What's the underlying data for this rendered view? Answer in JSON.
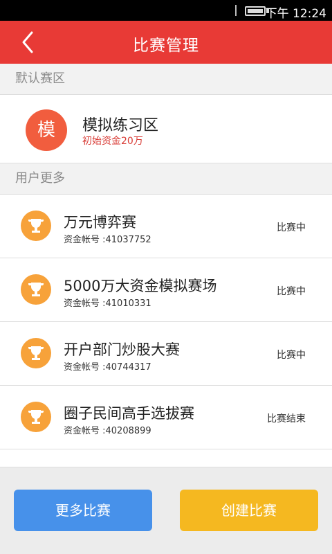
{
  "status_bar": {
    "time": "下午 12:24"
  },
  "header": {
    "title": "比赛管理"
  },
  "default_section": {
    "label": "默认赛区",
    "badge": "模",
    "name": "模拟练习区",
    "funds": "初始资金20万"
  },
  "more_section": {
    "label": "用户更多"
  },
  "competitions": [
    {
      "name": "万元博弈赛",
      "account": "资金帐号 :41037752",
      "status": "比赛中"
    },
    {
      "name": "5000万大资金模拟赛场",
      "account": "资金帐号 :41010331",
      "status": "比赛中"
    },
    {
      "name": "开户部门炒股大赛",
      "account": "资金帐号 :40744317",
      "status": "比赛中"
    },
    {
      "name": "圈子民间高手选拔赛",
      "account": "资金帐号 :40208899",
      "status": "比赛结束"
    }
  ],
  "buttons": {
    "more": "更多比赛",
    "create": "创建比赛"
  },
  "colors": {
    "header": "#e83a36",
    "trophy": "#f7a23a",
    "more_button": "#4791ea",
    "create_button": "#f5b820"
  }
}
